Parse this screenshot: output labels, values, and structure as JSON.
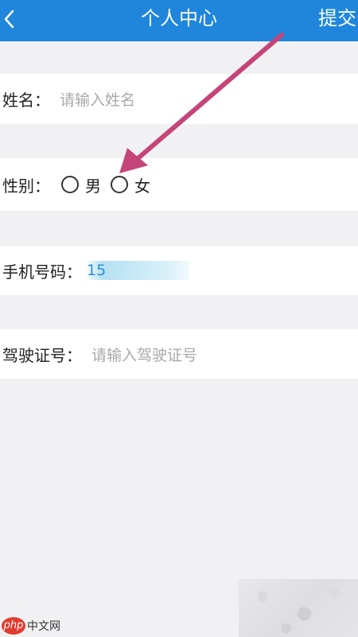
{
  "header": {
    "back_icon": "chevron-left-icon",
    "title": "个人中心",
    "submit_label": "提交"
  },
  "form": {
    "name": {
      "label": "姓名：",
      "placeholder": "请输入姓名"
    },
    "gender": {
      "label": "性别：",
      "options": [
        "男",
        "女"
      ],
      "selected": null
    },
    "phone": {
      "label": "手机号码：",
      "value": "15"
    },
    "license": {
      "label": "驾驶证号：",
      "placeholder": "请输入驾驶证号"
    }
  },
  "annotation": {
    "arrow_color": "#c5457a"
  },
  "watermark": {
    "logo": "php",
    "text": "中文网"
  },
  "colors": {
    "header_bg": "#1f86dc",
    "page_bg": "#f1f1f3"
  }
}
